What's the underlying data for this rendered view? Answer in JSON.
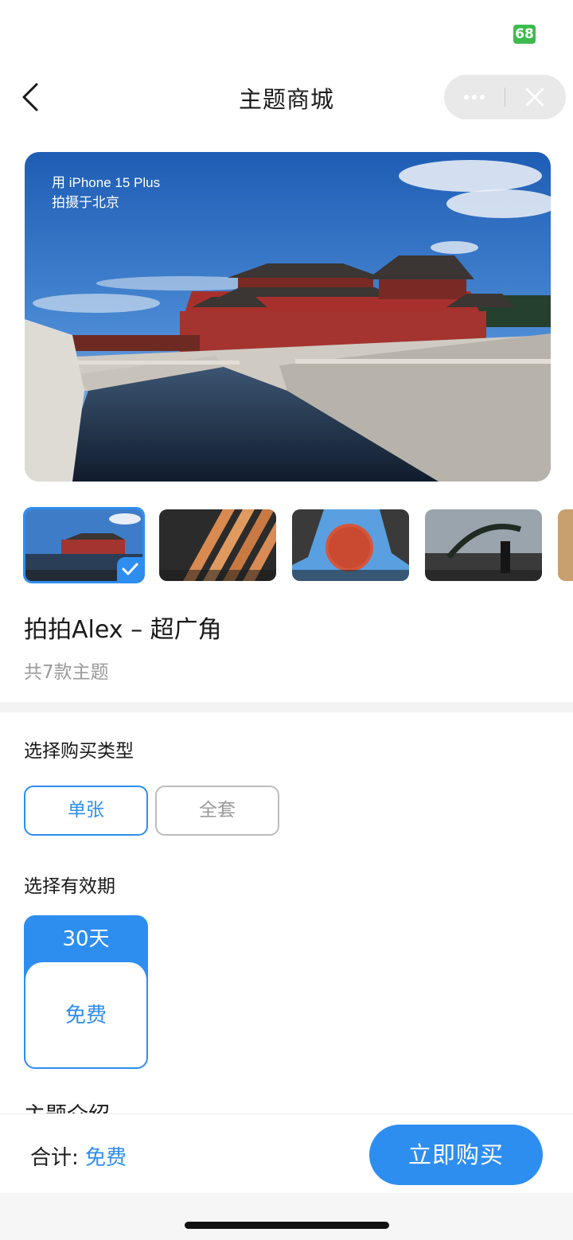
{
  "status": {
    "battery": "68"
  },
  "nav": {
    "title": "主题商城"
  },
  "hero": {
    "caption_line1": "用 iPhone 15 Plus",
    "caption_line2": "拍摄于北京"
  },
  "theme": {
    "title": "拍拍Alex – 超广角",
    "count": "共7款主题"
  },
  "purchase_type": {
    "label": "选择购买类型",
    "options": [
      "单张",
      "全套"
    ],
    "selected": "单张"
  },
  "validity": {
    "label": "选择有效期",
    "days": "30天",
    "price": "免费"
  },
  "partial_section_heading": "主题介绍",
  "footer": {
    "total_label": "合计: ",
    "total_value": "免费",
    "buy_label": "立即购买"
  },
  "colors": {
    "accent": "#2e8ef0",
    "battery": "#3dbb4d"
  },
  "icons": [
    "back-chevron-icon",
    "more-dots-icon",
    "close-icon",
    "checkmark-icon"
  ]
}
